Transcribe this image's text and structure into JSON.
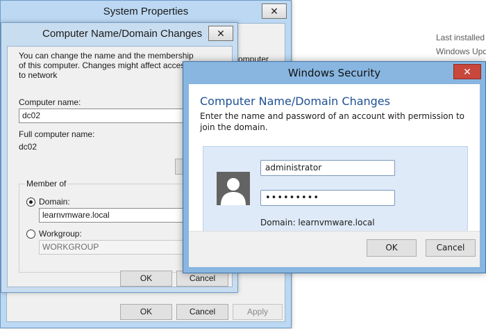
{
  "background": {
    "last_installed": "Last installed",
    "windows_update": "Windows Upd"
  },
  "system_properties": {
    "title": "System Properties",
    "partial_text": "omputer",
    "ok": "OK",
    "cancel": "Cancel",
    "apply": "Apply"
  },
  "domain_changes": {
    "title": "Computer Name/Domain Changes",
    "intro": "You can change the name and the membership of this computer. Changes might affect access to network",
    "computer_name_label": "Computer name:",
    "computer_name_value": "dc02",
    "full_name_label": "Full computer name:",
    "full_name_value": "dc02",
    "member_of": "Member of",
    "domain_label": "Domain:",
    "domain_value": "learnvmware.local",
    "workgroup_label": "Workgroup:",
    "workgroup_value": "WORKGROUP",
    "ok": "OK",
    "cancel": "Cancel"
  },
  "windows_security": {
    "title": "Windows Security",
    "heading": "Computer Name/Domain Changes",
    "description": "Enter the name and password of an account with permission to join the domain.",
    "username_value": "administrator",
    "password_value": "•••••••••",
    "domain_text": "Domain: learnvmware.local",
    "ok": "OK",
    "cancel": "Cancel"
  }
}
